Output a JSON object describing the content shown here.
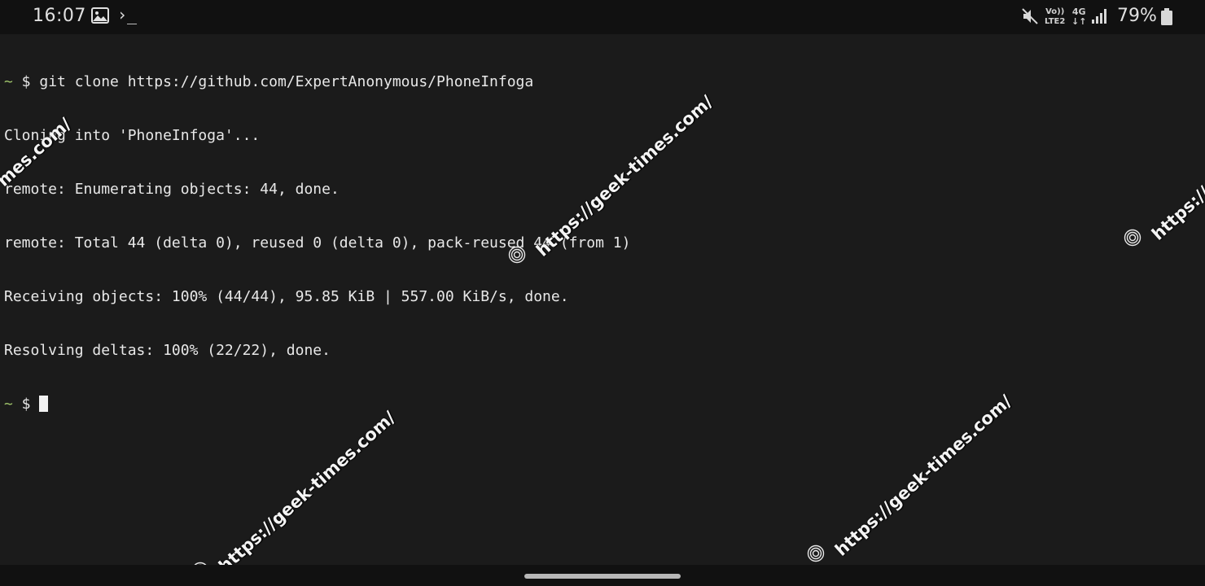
{
  "status_bar": {
    "time": "16:07",
    "terminal_glyph": "›_",
    "volte_line1": "Vo))",
    "volte_line2": "LTE2",
    "network_type": "4G",
    "network_arrows": "↓↑",
    "battery_percent": "79%",
    "icons": [
      "gallery-icon",
      "terminal-icon",
      "mute-icon",
      "signal-icon",
      "battery-icon"
    ]
  },
  "terminal": {
    "prompt_tilde": "~",
    "prompt_dollar": " $ ",
    "command": "git clone https://github.com/ExpertAnonymous/PhoneInfoga",
    "output_lines": [
      "Cloning into 'PhoneInfoga'...",
      "remote: Enumerating objects: 44, done.",
      "remote: Total 44 (delta 0), reused 0 (delta 0), pack-reused 44 (from 1)",
      "Receiving objects: 100% (44/44), 95.85 KiB | 557.00 KiB/s, done.",
      "Resolving deltas: 100% (22/22), done."
    ],
    "colors": {
      "background": "#1b1b1b",
      "text": "#e8e8e8",
      "prompt_tilde": "#9ec36a",
      "cursor": "#f2f2f2"
    }
  },
  "watermark": {
    "text": "https://geek-times.com/",
    "partial_left": "mes.com/",
    "partial_right": "https://gee"
  }
}
